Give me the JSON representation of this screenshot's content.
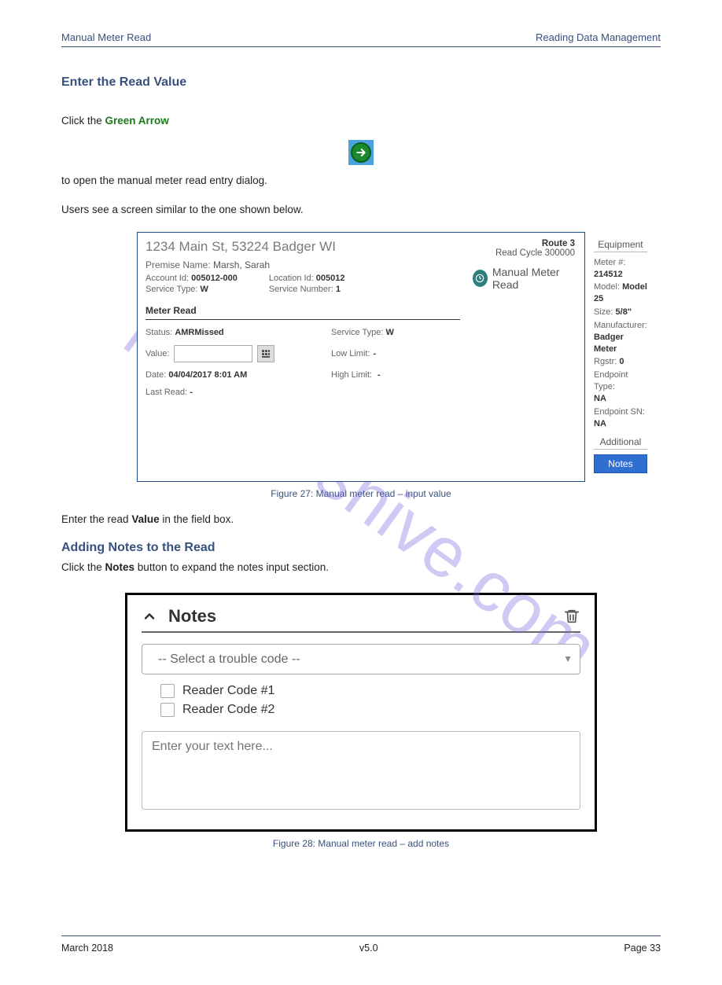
{
  "header": {
    "left": "Manual Meter Read",
    "right": "Reading Data Management"
  },
  "intro": {
    "para1_prefix": "Click the ",
    "para1_green_bold": "Green Arrow",
    "para1_after_icon": " to open the manual meter read entry dialog.",
    "para2": "Users see a screen similar to the one shown below."
  },
  "section_title_input": "Enter the Read Value",
  "fig27": {
    "address": "1234 Main St, 53224 Badger WI",
    "premise_name_label": "Premise Name:",
    "premise_name": "Marsh, Sarah",
    "account_id_label": "Account Id:",
    "account_id": "005012-000",
    "service_type_label": "Service Type:",
    "service_type": "W",
    "location_id_label": "Location Id:",
    "location_id": "005012",
    "service_number_label": "Service Number:",
    "service_number": "1",
    "route_label": "Route 3",
    "read_cycle_label": "Read Cycle 300000",
    "manual_meter_read": "Manual Meter Read",
    "equipment_title": "Equipment",
    "equip": {
      "meter_no_label": "Meter #:",
      "meter_no": "214512",
      "model_label": "Model:",
      "model": "Model 25",
      "size_label": "Size:",
      "size": "5/8\"",
      "mfr_label": "Manufacturer:",
      "mfr": "Badger Meter",
      "rgstr_label": "Rgstr:",
      "rgstr": "0",
      "endpoint_type_label": "Endpoint Type:",
      "endpoint_type": "NA",
      "endpoint_sn_label": "Endpoint SN:",
      "endpoint_sn": "NA"
    },
    "additional_title": "Additional",
    "notes_btn": "Notes",
    "meter_read_title": "Meter Read",
    "read": {
      "status_label": "Status:",
      "status": "AMRMissed",
      "value_label": "Value:",
      "value": "",
      "date_label": "Date:",
      "date": "04/04/2017 8:01 AM",
      "last_read_label": "Last Read:",
      "last_read": "-",
      "svctype_label": "Service Type:",
      "svctype": "W",
      "low_limit_label": "Low Limit:",
      "low_limit": "-",
      "high_limit_label": "High Limit:",
      "high_limit": "-"
    },
    "caption": "Figure 27: Manual meter read – input value"
  },
  "input_instruction": {
    "prefix": "Enter the read ",
    "bold": "Value",
    "suffix": " in the field box."
  },
  "section_title_notes": "Adding Notes to the Read",
  "notes_instruction_prefix": "Click the ",
  "notes_instruction_bold": "Notes",
  "notes_instruction_suffix": " button to expand the notes input section.",
  "fig28": {
    "title": "Notes",
    "select_placeholder": "-- Select a trouble code --",
    "reader_code_1": "Reader Code #1",
    "reader_code_2": "Reader Code #2",
    "textarea_placeholder": "Enter your text here...",
    "caption": "Figure 28: Manual meter read – add notes"
  },
  "footer": {
    "left": "March 2018",
    "center": "v5.0",
    "right": "Page 33"
  },
  "watermark": "manualshive.com"
}
